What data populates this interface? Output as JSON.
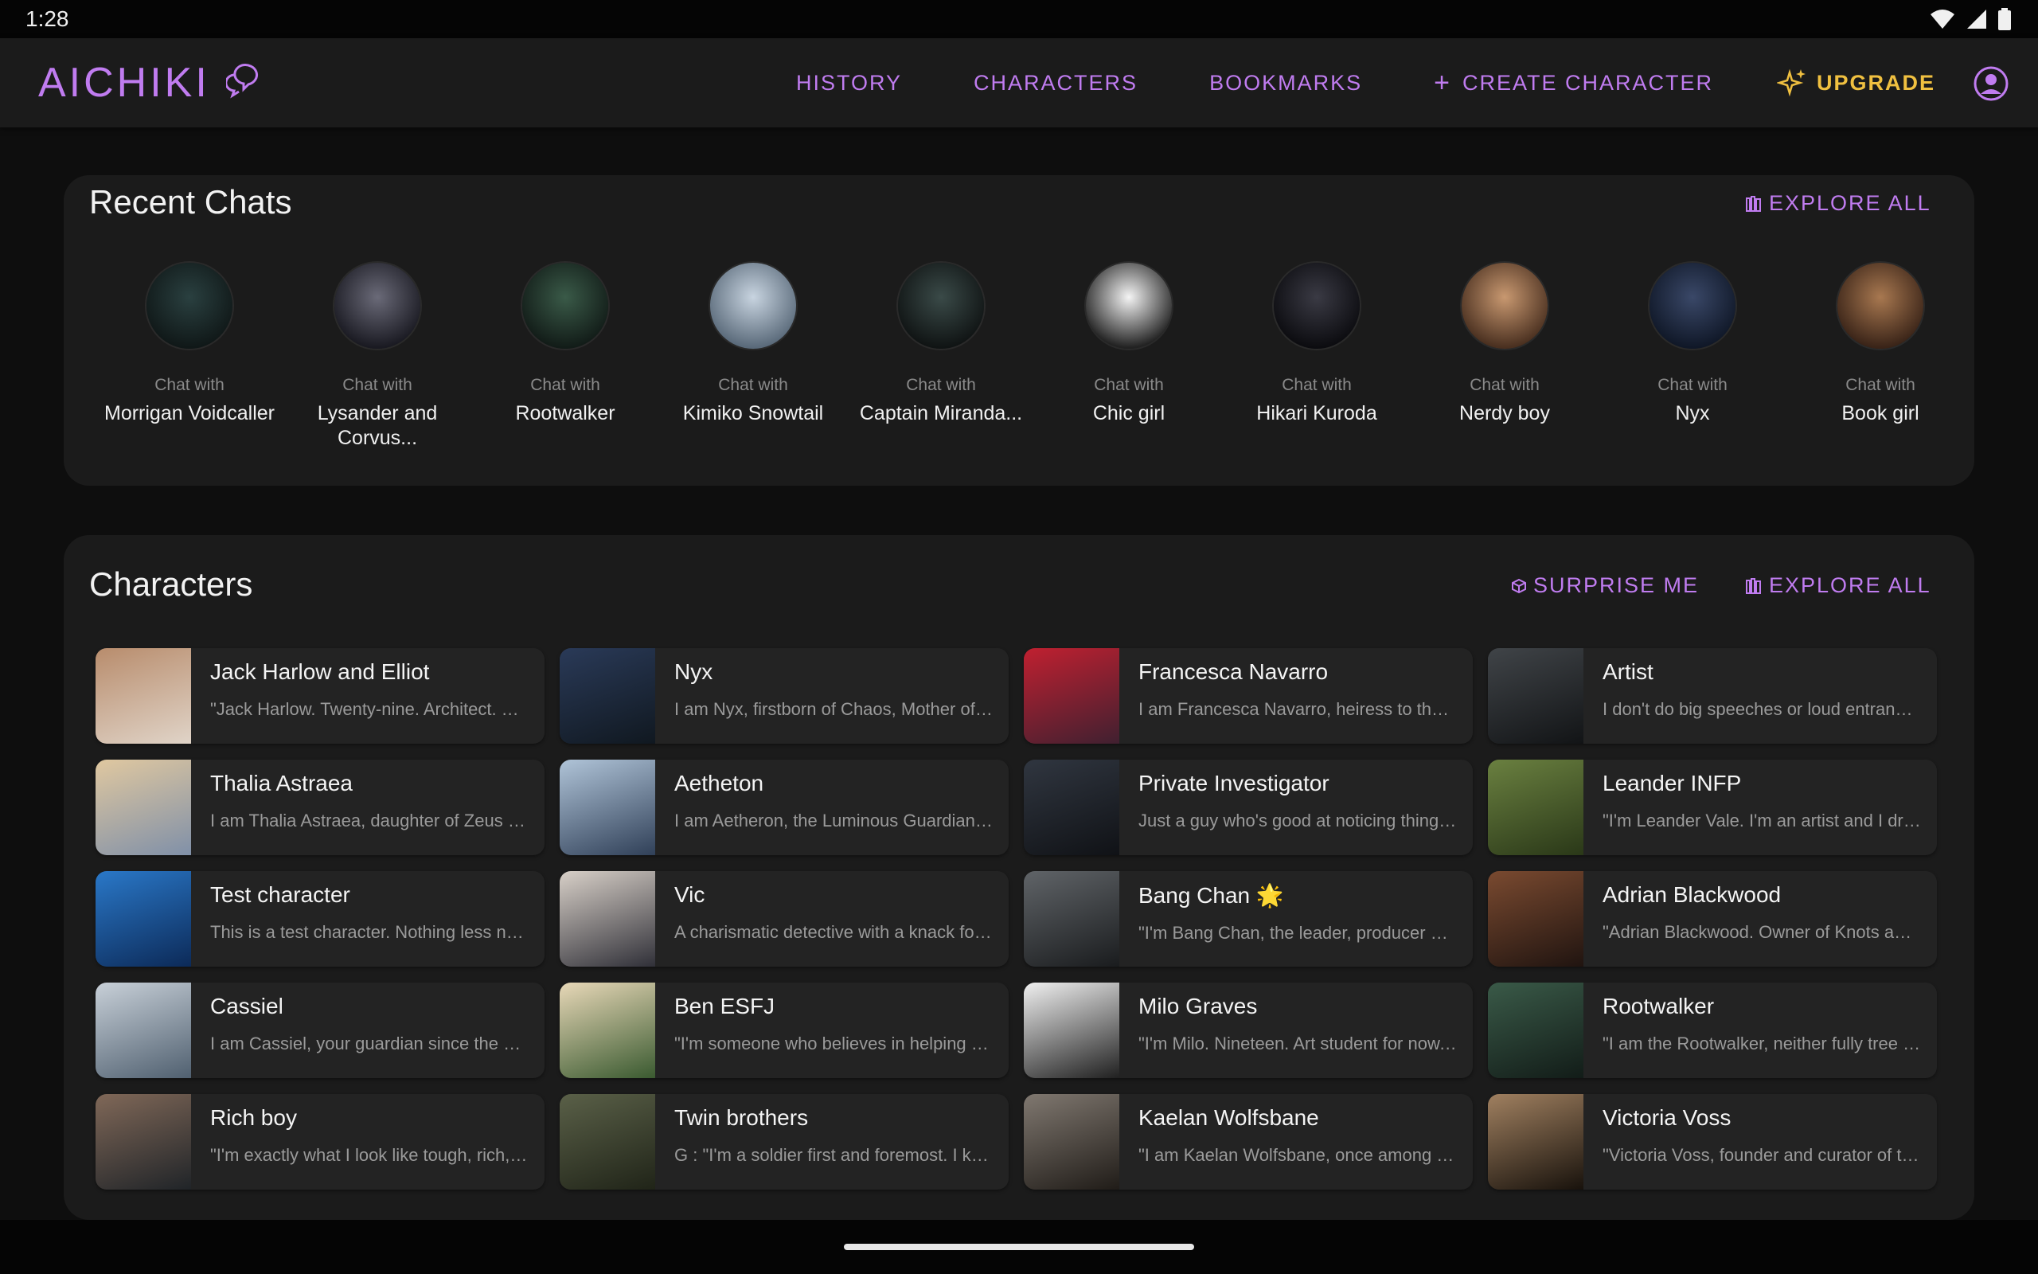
{
  "status": {
    "time": "1:28"
  },
  "nav": {
    "logo": "AICHIKI",
    "links": [
      "HISTORY",
      "CHARACTERS",
      "BOOKMARKS"
    ],
    "create": "CREATE CHARACTER",
    "upgrade": "UPGRADE"
  },
  "colors": {
    "accent": "#c07cf0",
    "upgrade": "#f0c040",
    "card": "#1b1b1b",
    "tile": "#232323"
  },
  "recent": {
    "title": "Recent Chats",
    "explore": "EXPLORE ALL",
    "prefix": "Chat with",
    "items": [
      {
        "name": "Morrigan Voidcaller",
        "c1": "#2a4040",
        "c2": "#101818"
      },
      {
        "name": "Lysander and Corvus...",
        "c1": "#6a6a78",
        "c2": "#1a1a22"
      },
      {
        "name": "Rootwalker",
        "c1": "#3a5a48",
        "c2": "#121c18"
      },
      {
        "name": "Kimiko Snowtail",
        "c1": "#c8d4e0",
        "c2": "#5a6a7a"
      },
      {
        "name": "Captain Miranda...",
        "c1": "#3a4a48",
        "c2": "#101414"
      },
      {
        "name": "Chic girl",
        "c1": "#f4f4f4",
        "c2": "#222222"
      },
      {
        "name": "Hikari Kuroda",
        "c1": "#3a3a44",
        "c2": "#0c0c10"
      },
      {
        "name": "Nerdy boy",
        "c1": "#c89870",
        "c2": "#4a3020"
      },
      {
        "name": "Nyx",
        "c1": "#3a4868",
        "c2": "#101828"
      },
      {
        "name": "Book girl",
        "c1": "#a87850",
        "c2": "#3a2418"
      }
    ]
  },
  "characters": {
    "title": "Characters",
    "surprise": "SURPRISE ME",
    "explore": "EXPLORE ALL",
    "rows": [
      [
        {
          "name": "Jack Harlow and Elliot",
          "desc": "\"Jack Harlow. Twenty-nine. Architect. Single dad to",
          "c1": "#b88c6c",
          "c2": "#e0d4c8"
        },
        {
          "name": "Nyx",
          "desc": "I am Nyx, firstborn of Chaos, Mother of the Night and",
          "c1": "#2a3a58",
          "c2": "#101820"
        },
        {
          "name": "Francesca Navarro",
          "desc": "I am Francesca Navarro, heiress to the Navarro empire",
          "c1": "#c02030",
          "c2": "#402030"
        },
        {
          "name": "Artist",
          "desc": "I don't do big speeches or loud entrances. I notice",
          "c1": "#404448",
          "c2": "#121416"
        }
      ],
      [
        {
          "name": "Thalia Astraea",
          "desc": "I am Thalia Astraea, daughter of Zeus and guardian of",
          "c1": "#e0c8a0",
          "c2": "#8090a8"
        },
        {
          "name": "Aetheton",
          "desc": "I am Aetheron, the Luminous Guardian of the celestial",
          "c1": "#b0c4d8",
          "c2": "#304058"
        },
        {
          "name": "Private Investigator",
          "desc": "Just a guy who's good at noticing things others miss",
          "c1": "#303640",
          "c2": "#101216"
        },
        {
          "name": "Leander INFP",
          "desc": "\"I'm Leander Vale. I'm an artist and I draw what I",
          "c1": "#6a8040",
          "c2": "#2a3818"
        }
      ],
      [
        {
          "name": "Test character",
          "desc": "This is a test character. Nothing less nothing more",
          "c1": "#2a78c8",
          "c2": "#0c2a58"
        },
        {
          "name": "Vic",
          "desc": "A charismatic detective with a knack for solving",
          "c1": "#d8d0c8",
          "c2": "#303038"
        },
        {
          "name": "Bang Chan 🌟",
          "desc": "\"I'm Bang Chan, the leader, producer and heart of",
          "c1": "#606468",
          "c2": "#1a1c1e"
        },
        {
          "name": "Adrian Blackwood",
          "desc": "\"Adrian Blackwood. Owner of Knots and Co, a luxury",
          "c1": "#7a4a30",
          "c2": "#201410"
        }
      ],
      [
        {
          "name": "Cassiel",
          "desc": "I am Cassiel, your guardian since the day you were",
          "c1": "#c8d0d8",
          "c2": "#506070"
        },
        {
          "name": "Ben ESFJ",
          "desc": "\"I'm someone who believes in helping people and",
          "c1": "#e8d8b8",
          "c2": "#3a5a30"
        },
        {
          "name": "Milo Graves",
          "desc": "\"I'm Milo. Nineteen. Art student for now. I don't",
          "c1": "#f0f0f0",
          "c2": "#202020"
        },
        {
          "name": "Rootwalker",
          "desc": "\"I am the Rootwalker, neither fully tree nor fully",
          "c1": "#3a5a48",
          "c2": "#121c18"
        }
      ],
      [
        {
          "name": "Rich boy",
          "desc": "\"I'm exactly what I look like tough, rich, and",
          "c1": "#806858",
          "c2": "#202428"
        },
        {
          "name": "Twin brothers",
          "desc": "G : \"I'm a soldier first and foremost. I keep my",
          "c1": "#5a6048",
          "c2": "#202418"
        },
        {
          "name": "Kaelan Wolfsbane",
          "desc": "\"I am Kaelan Wolfsbane, once among the most feared",
          "c1": "#807870",
          "c2": "#201c18"
        },
        {
          "name": "Victoria Voss",
          "desc": "\"Victoria Voss, founder and curator of the Voss",
          "c1": "#a08060",
          "c2": "#18120c"
        }
      ]
    ]
  }
}
